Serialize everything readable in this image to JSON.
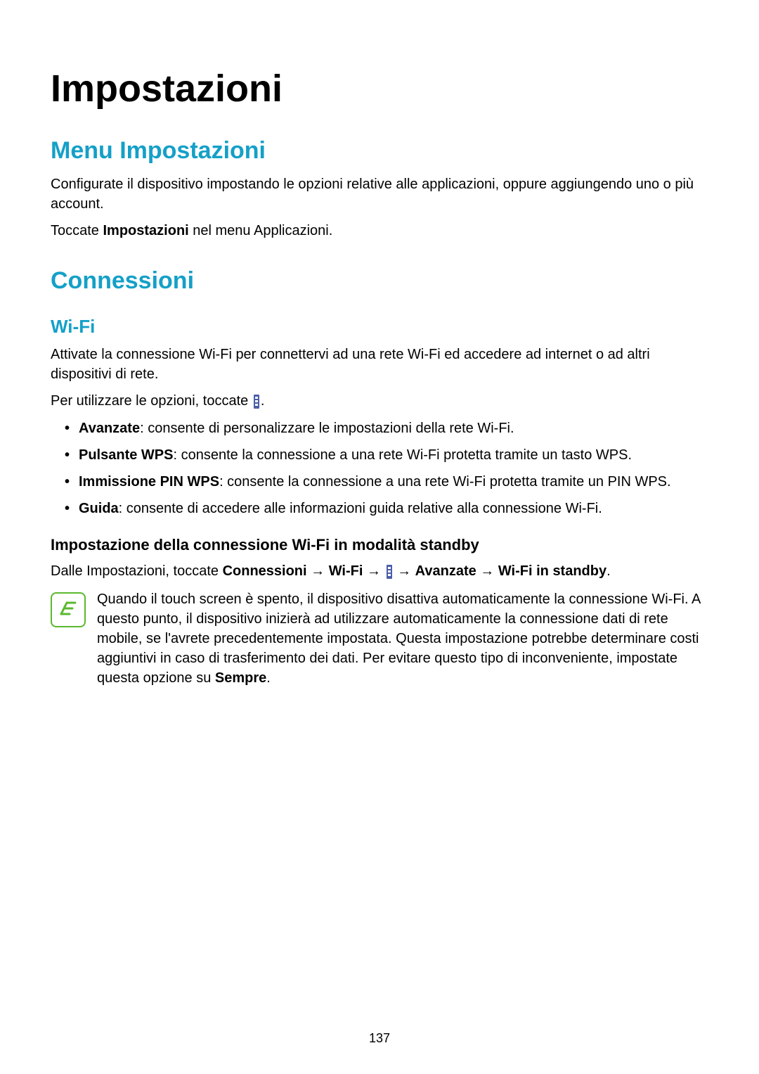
{
  "page": {
    "title": "Impostazioni",
    "number": "137"
  },
  "section_menu": {
    "title": "Menu Impostazioni",
    "p1": "Configurate il dispositivo impostando le opzioni relative alle applicazioni, oppure aggiungendo uno o più account.",
    "p2_prefix": "Toccate ",
    "p2_bold": "Impostazioni",
    "p2_suffix": " nel menu Applicazioni."
  },
  "section_conn": {
    "title": "Connessioni",
    "wifi": {
      "title": "Wi-Fi",
      "p1": "Attivate la connessione Wi-Fi per connettervi ad una rete Wi-Fi ed accedere ad internet o ad altri dispositivi di rete.",
      "p2_prefix": "Per utilizzare le opzioni, toccate ",
      "p2_suffix": ".",
      "options": [
        {
          "b": "Avanzate",
          "t": ": consente di personalizzare le impostazioni della rete Wi-Fi."
        },
        {
          "b": "Pulsante WPS",
          "t": ": consente la connessione a una rete Wi-Fi protetta tramite un tasto WPS."
        },
        {
          "b": "Immissione PIN WPS",
          "t": ": consente la connessione a una rete Wi-Fi protetta tramite un PIN WPS."
        },
        {
          "b": "Guida",
          "t": ": consente di accedere alle informazioni guida relative alla connessione Wi-Fi."
        }
      ],
      "standby": {
        "title": "Impostazione della connessione Wi-Fi in modalità standby",
        "prefix": "Dalle Impostazioni, toccate ",
        "path1": "Connessioni",
        "arrow": " → ",
        "path2": "Wi-Fi",
        "path3": "Avanzate",
        "path4": "Wi-Fi in standby",
        "suffix": "."
      },
      "note": {
        "prefix": "Quando il touch screen è spento, il dispositivo disattiva automaticamente la connessione Wi-Fi. A questo punto, il dispositivo inizierà ad utilizzare automaticamente la connessione dati di rete mobile, se l'avrete precedentemente impostata. Questa impostazione potrebbe determinare costi aggiuntivi in caso di trasferimento dei dati. Per evitare questo tipo di inconveniente, impostate questa opzione su ",
        "bold": "Sempre",
        "suffix": "."
      }
    }
  }
}
